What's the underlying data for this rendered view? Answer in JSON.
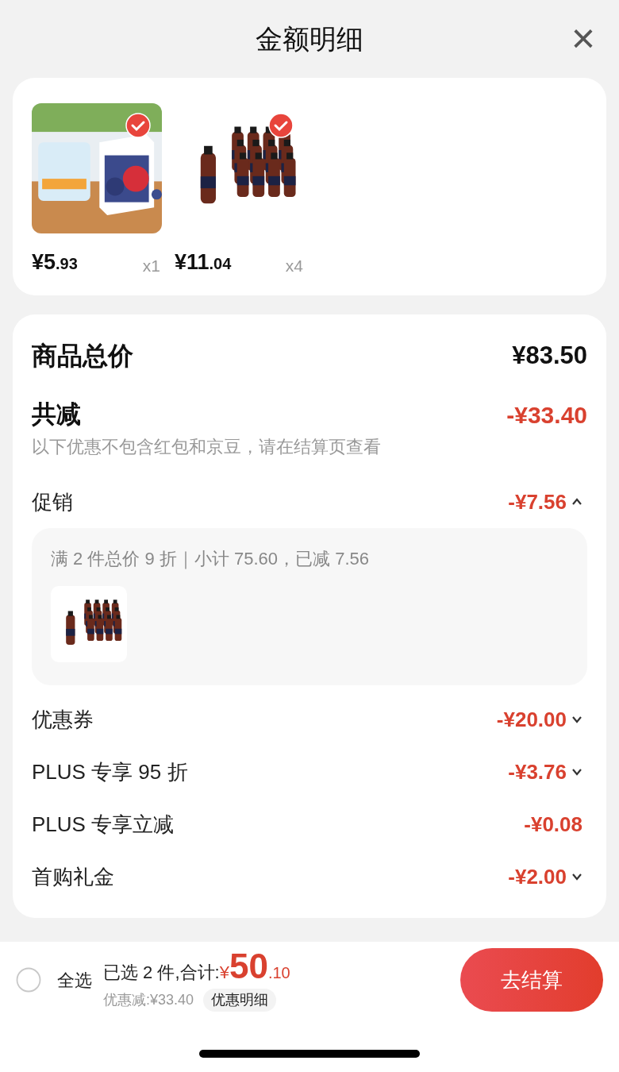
{
  "header": {
    "title": "金额明细",
    "close": "×"
  },
  "products": [
    {
      "kind": "juice",
      "checked": true,
      "price_main": "¥5",
      "price_decimal": ".93",
      "quantity": "x1"
    },
    {
      "kind": "cola",
      "checked": true,
      "price_main": "¥11",
      "price_decimal": ".04",
      "quantity": "x4"
    }
  ],
  "summary": {
    "total_label": "商品总价",
    "total_value": "¥83.50",
    "reduction_label": "共减",
    "reduction_value": "-¥33.40",
    "note": "以下优惠不包含红包和京豆，请在结算页查看"
  },
  "discounts": [
    {
      "label": "促销",
      "value": "-¥7.56",
      "kind": "expandable",
      "expanded": true,
      "detail": {
        "text": "满 2 件总价 9 折｜小计 75.60，已减 7.56",
        "products": [
          {
            "kind": "cola"
          }
        ]
      }
    },
    {
      "label": "优惠券",
      "value": "-¥20.00",
      "kind": "expandable",
      "expanded": false
    },
    {
      "label": "PLUS 专享 95 折",
      "value": "-¥3.76",
      "kind": "expandable",
      "expanded": false
    },
    {
      "label": "PLUS 专享立减",
      "value": "-¥0.08",
      "kind": "plain"
    },
    {
      "label": "首购礼金",
      "value": "-¥2.00",
      "kind": "expandable",
      "expanded": false
    }
  ],
  "footer": {
    "select_all": {
      "label": "全选",
      "checked": false
    },
    "selected_text": "已选 2 件,合计:",
    "currency": "¥",
    "total_main": "50",
    "total_decimal": ".10",
    "saved": "优惠减:¥33.40",
    "detail_button": "优惠明细",
    "checkout": "去结算"
  }
}
